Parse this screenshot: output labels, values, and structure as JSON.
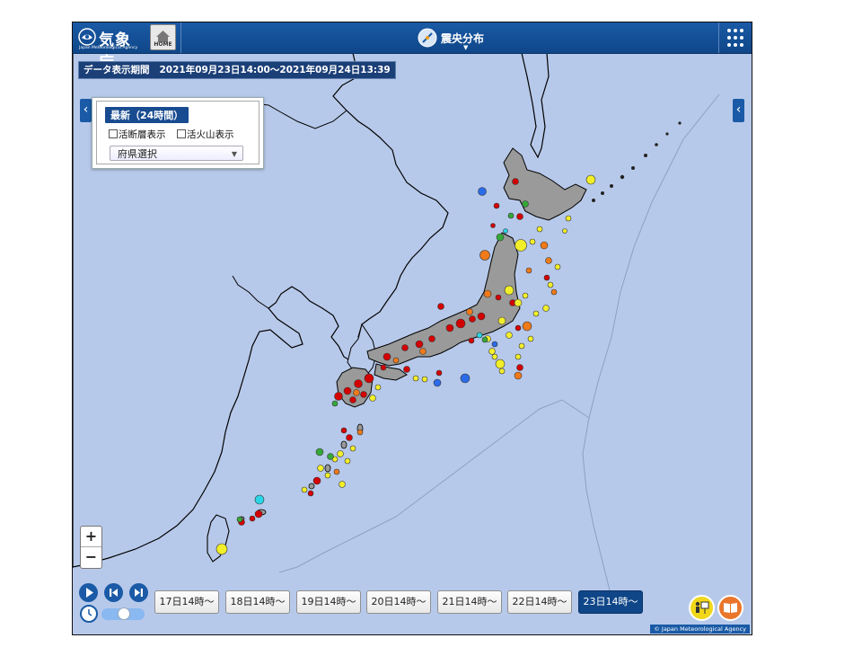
{
  "header": {
    "logo_name": "気象庁",
    "logo_sub": "Japan Meteorological Agency",
    "home_label": "HOME",
    "title": "震央分布",
    "dropdown_glyph": "▼"
  },
  "period": {
    "label": "データ表示期間",
    "range": "2021年09月23日14:00～2021年09月24日13:39"
  },
  "panel": {
    "badge": "最新（24時間）",
    "checkbox_fault": "活断層表示",
    "checkbox_volcano": "活火山表示",
    "prefecture_select": "府県選択"
  },
  "zoom": {
    "in": "+",
    "out": "−"
  },
  "timeline": {
    "buttons": [
      "17日14時～",
      "18日14時～",
      "19日14時～",
      "20日14時～",
      "21日14時～",
      "22日14時～",
      "23日14時～"
    ],
    "active_index": 6
  },
  "credit": "© Japan Meteorological Agency",
  "colors": {
    "header": "#1a5aa6",
    "sea": "#b7c9ea",
    "land": "#9a9a9a",
    "active_button": "#0f4688",
    "depth_shallow": "#d40000",
    "depth_mid": "#f07a1a",
    "depth_deeper": "#f2ee2a",
    "depth_deep": "#36a83a",
    "depth_very_deep": "#2a6ce8",
    "depth_deepest": "#2ad6e6"
  }
}
